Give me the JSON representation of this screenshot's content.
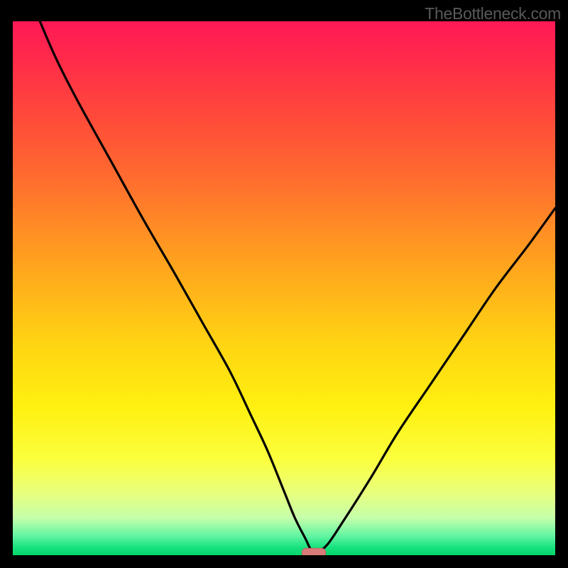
{
  "watermark": "TheBottleneck.com",
  "colors": {
    "frame_bg": "#000000",
    "gradient_stops": [
      {
        "offset": 0.0,
        "color": "#ff1956"
      },
      {
        "offset": 0.07,
        "color": "#ff2a4a"
      },
      {
        "offset": 0.18,
        "color": "#ff4a3a"
      },
      {
        "offset": 0.3,
        "color": "#ff6e2e"
      },
      {
        "offset": 0.45,
        "color": "#ffa21e"
      },
      {
        "offset": 0.6,
        "color": "#ffd313"
      },
      {
        "offset": 0.72,
        "color": "#fff010"
      },
      {
        "offset": 0.82,
        "color": "#fbff3d"
      },
      {
        "offset": 0.88,
        "color": "#eaff7a"
      },
      {
        "offset": 0.93,
        "color": "#c6ffab"
      },
      {
        "offset": 0.965,
        "color": "#5ef4a1"
      },
      {
        "offset": 0.985,
        "color": "#18e37e"
      },
      {
        "offset": 1.0,
        "color": "#05d46b"
      }
    ],
    "curve_stroke": "#000000",
    "marker_fill": "#d97b78",
    "marker_outline": "#c46461"
  },
  "chart_data": {
    "type": "line",
    "title": "",
    "xlabel": "",
    "ylabel": "",
    "xlim": [
      0,
      100
    ],
    "ylim": [
      0,
      100
    ],
    "note": "Axes are unlabeled in the source image; x is treated as horizontal percent across the plot, y as bottleneck percent (0 at bottom / green, 100 at top / red). Values estimated from pixel positions.",
    "series": [
      {
        "name": "bottleneck-curve",
        "x": [
          5,
          8,
          12,
          18,
          24,
          30,
          35,
          40,
          44,
          47,
          50,
          52,
          54,
          55,
          56,
          58,
          61,
          66,
          71,
          77,
          83,
          89,
          95,
          100
        ],
        "y": [
          100,
          93,
          85,
          74,
          63,
          52.5,
          43.5,
          34.5,
          26,
          19.5,
          12,
          7,
          3,
          1,
          0.5,
          2,
          6.5,
          14.5,
          23,
          32,
          41,
          50,
          58,
          65
        ]
      }
    ],
    "marker": {
      "x_center": 55.5,
      "x_halfwidth": 2.2,
      "y": 0.5
    }
  }
}
